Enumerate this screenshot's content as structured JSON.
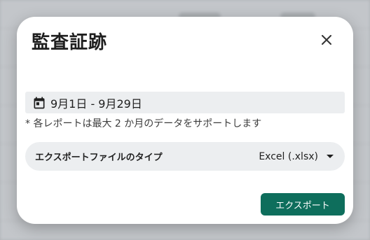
{
  "dialog": {
    "title": "監査証跡",
    "date_range": "9月1日 - 9月29日",
    "note": "* 各レポートは最大 2 か月のデータをサポートします",
    "file_type": {
      "label": "エクスポートファイルのタイプ",
      "value": "Excel (.xlsx)"
    },
    "export_label": "エクスポート"
  },
  "icons": {
    "close": "close-icon",
    "calendar": "calendar-icon",
    "dropdown": "caret-down-icon"
  },
  "colors": {
    "accent": "#0e6e5c",
    "field_bg": "#eceef0",
    "backdrop": "#c3c6ca"
  }
}
